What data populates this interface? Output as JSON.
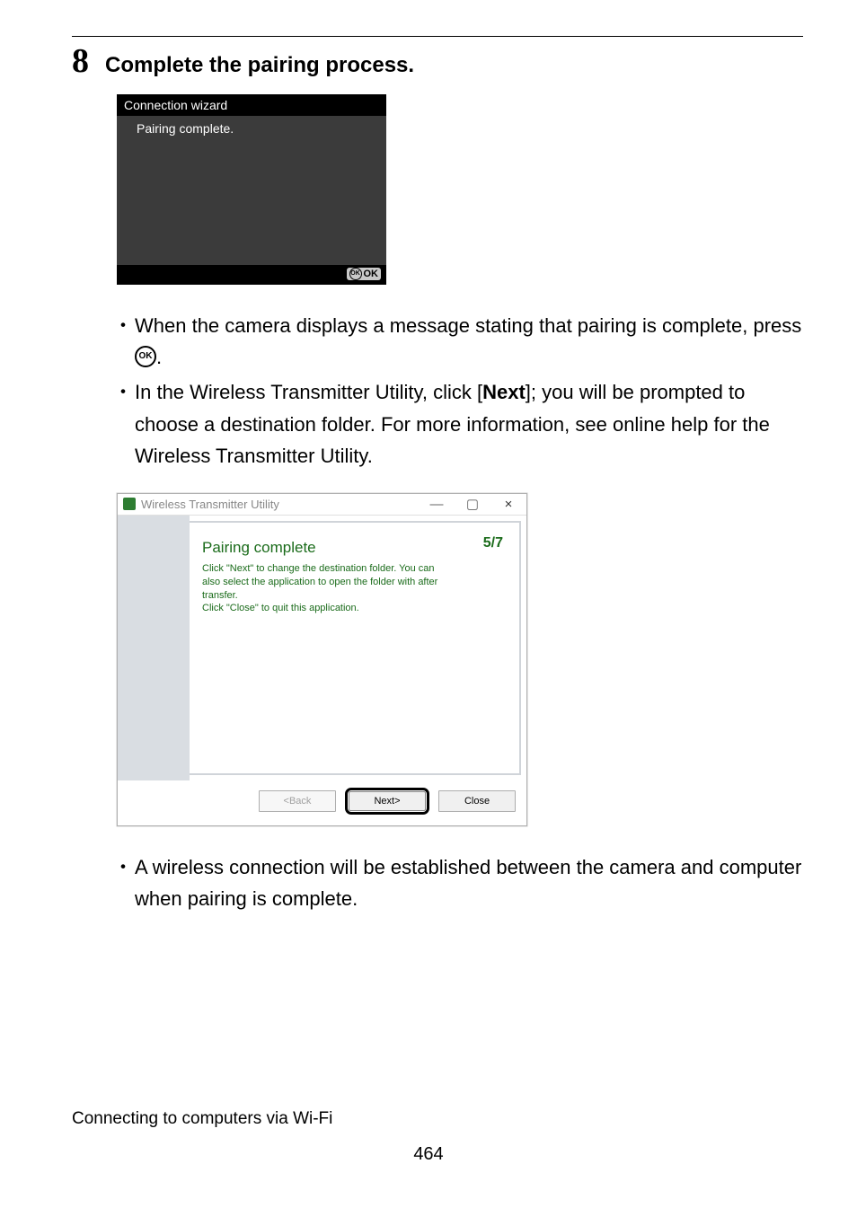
{
  "step": {
    "number": "8",
    "title": "Complete the pairing process."
  },
  "camera_screen": {
    "title": "Connection wizard",
    "message": "Pairing complete.",
    "ok_icon_label": "OK",
    "ok_label": "OK"
  },
  "bullets_upper": [
    {
      "pre": "When the camera displays a message stating that pairing is complete, press ",
      "ok_inline": "OK",
      "post": "."
    },
    {
      "pre": "In the Wireless Transmitter Utility, click [",
      "bold": "Next",
      "post": "]; you will be prompted to choose a destination folder. For more information, see online help for the Wireless Transmitter Utility."
    }
  ],
  "dialog": {
    "app_title": "Wireless Transmitter Utility",
    "step_counter": "5/7",
    "heading": "Pairing complete",
    "desc_line1": "Click \"Next\" to change the destination folder. You can also select the application to open the folder with after transfer.",
    "desc_line2": "Click \"Close\" to quit this application.",
    "btn_back": "<Back",
    "btn_next": "Next>",
    "btn_close": "Close"
  },
  "bullet_lower": "A wireless connection will be established between the camera and computer when pairing is complete.",
  "footer_left": "Connecting to computers via Wi-Fi",
  "page_number": "464",
  "window_controls": {
    "min": "—",
    "max": "▢",
    "close": "×"
  }
}
